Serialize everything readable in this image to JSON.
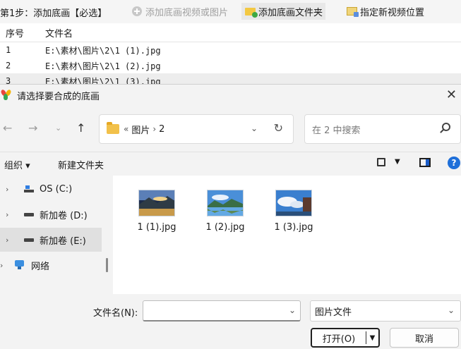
{
  "app": {
    "step_label": "第1步：添加底画【必选】",
    "buttons": [
      {
        "label": "添加底画视频或图片",
        "icon": "circle-plus-icon",
        "enabled": false
      },
      {
        "label": "添加底画文件夹",
        "icon": "add-folder-icon",
        "enabled": true
      },
      {
        "label": "指定新视频位置",
        "icon": "image-location-icon",
        "enabled": true
      }
    ],
    "table": {
      "columns": [
        "序号",
        "文件名"
      ],
      "rows": [
        {
          "index": "1",
          "name": "E:\\素材\\图片\\2\\1 (1).jpg"
        },
        {
          "index": "2",
          "name": "E:\\素材\\图片\\2\\1 (2).jpg"
        },
        {
          "index": "3",
          "name": "E:\\素材\\图片\\2\\1 (3).jpg"
        }
      ]
    }
  },
  "dialog": {
    "title": "请选择要合成的底画",
    "address": {
      "parts": [
        "图片",
        "2"
      ],
      "prefix": "«"
    },
    "search_placeholder": "在 2 中搜索",
    "commands": {
      "organize": "组织 ▾",
      "new_folder": "新建文件夹"
    },
    "tree": [
      {
        "label": "OS (C:)",
        "icon": "os-drive-icon",
        "selected": false
      },
      {
        "label": "新加卷 (D:)",
        "icon": "drive-icon",
        "selected": false
      },
      {
        "label": "新加卷 (E:)",
        "icon": "drive-icon",
        "selected": true
      },
      {
        "label": "网络",
        "icon": "network-icon",
        "selected": false
      }
    ],
    "files": [
      {
        "name": "1 (1).jpg"
      },
      {
        "name": "1 (2).jpg"
      },
      {
        "name": "1 (3).jpg"
      }
    ],
    "filename_label": "文件名(N):",
    "filename_value": "",
    "filetype": "图片文件",
    "open_label": "打开(O)",
    "cancel_label": "取消"
  },
  "colors": {
    "accent": "#1e6fd9",
    "folder": "#f2c14a",
    "window_bg": "#f3f3f3"
  }
}
